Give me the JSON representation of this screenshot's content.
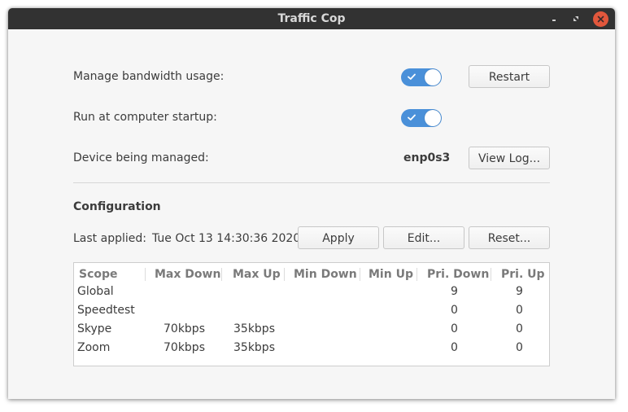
{
  "window": {
    "title": "Traffic Cop"
  },
  "settings": {
    "manage_label": "Manage bandwidth usage:",
    "startup_label": "Run at computer startup:",
    "device_label": "Device being managed:",
    "device_value": "enp0s3",
    "manage_enabled": true,
    "startup_enabled": true,
    "restart_label": "Restart",
    "view_log_label": "View Log..."
  },
  "configuration": {
    "title": "Configuration",
    "last_applied_label": "Last applied:",
    "last_applied_value": "Tue Oct 13 14:30:36 2020",
    "apply_label": "Apply",
    "edit_label": "Edit...",
    "reset_label": "Reset..."
  },
  "table": {
    "headers": [
      "Scope",
      "Max Down",
      "Max Up",
      "Min Down",
      "Min Up",
      "Pri. Down",
      "Pri. Up"
    ],
    "rows": [
      [
        "Global",
        "",
        "",
        "",
        "",
        "9",
        "9"
      ],
      [
        "Speedtest",
        "",
        "",
        "",
        "",
        "0",
        "0"
      ],
      [
        "Skype",
        "70kbps",
        "35kbps",
        "",
        "",
        "0",
        "0"
      ],
      [
        "Zoom",
        "70kbps",
        "35kbps",
        "",
        "",
        "0",
        "0"
      ]
    ]
  },
  "colors": {
    "titlebar": "#323232",
    "accent": "#4a90d9",
    "close": "#e2573c"
  }
}
